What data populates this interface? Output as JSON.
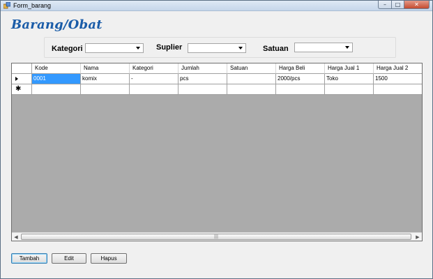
{
  "window": {
    "title": "Form_barang",
    "min": "–",
    "max": "□",
    "close": "✕"
  },
  "heading": "Barang/Obat",
  "filters": {
    "kategori_label": "Kategori",
    "suplier_label": "Suplier",
    "satuan_label": "Satuan"
  },
  "grid": {
    "columns": [
      "Kode",
      "Nama",
      "Kategori",
      "Jumlah",
      "Satuan",
      "Harga Beli",
      "Harga Jual 1",
      "Harga Jual 2"
    ],
    "rows": [
      [
        "0001",
        "komix",
        "-",
        "pcs",
        "",
        "2000/pcs",
        "Toko",
        "1500"
      ]
    ],
    "new_row_marker": "✱",
    "scroll_thumb_grip": "|||"
  },
  "buttons": {
    "tambah": "Tambah",
    "edit": "Edit",
    "hapus": "Hapus"
  }
}
